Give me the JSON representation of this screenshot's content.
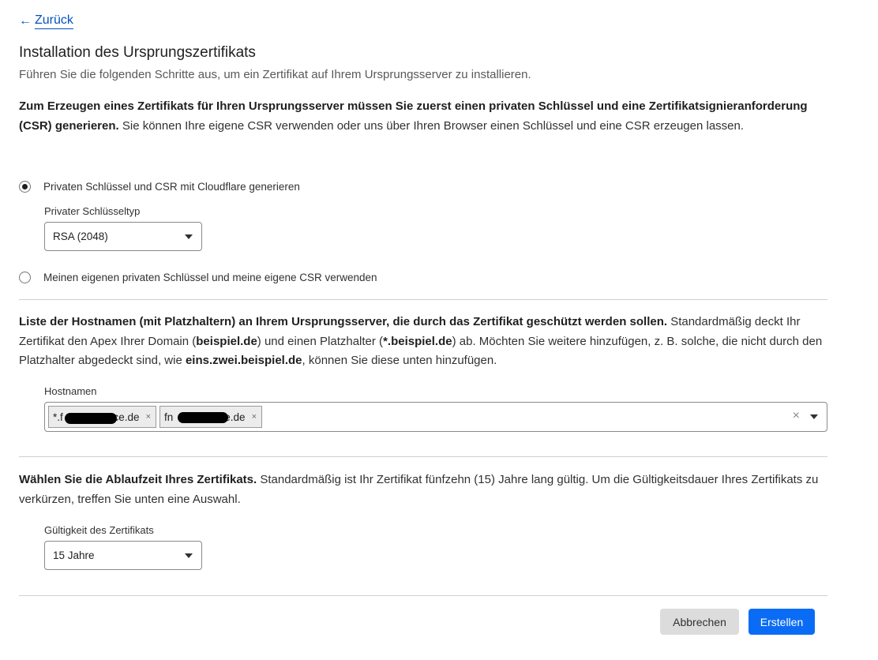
{
  "nav": {
    "back_arrow": "←",
    "back_label": "Zurück"
  },
  "header": {
    "title": "Installation des Ursprungszertifikats",
    "subtitle": "Führen Sie die folgenden Schritte aus, um ein Zertifikat auf Ihrem Ursprungsserver zu installieren."
  },
  "key_section": {
    "intro_bold": "Zum Erzeugen eines Zertifikats für Ihren Ursprungsserver müssen Sie zuerst einen privaten Schlüssel und eine Zertifikatsignieranforderung (CSR) generieren.",
    "intro_rest": " Sie können Ihre eigene CSR verwenden oder uns über Ihren Browser einen Schlüssel und eine CSR erzeugen lassen.",
    "option_generate": {
      "label": "Privaten Schlüssel und CSR mit Cloudflare generieren",
      "selected": true
    },
    "key_type_label": "Privater Schlüsseltyp",
    "key_type_value": "RSA (2048)",
    "option_own": {
      "label": "Meinen eigenen privaten Schlüssel und meine eigene CSR verwenden",
      "selected": false
    }
  },
  "hostnames_section": {
    "intro_bold": "Liste der Hostnamen (mit Platzhaltern) an Ihrem Ursprungsserver, die durch das Zertifikat geschützt werden sollen.",
    "intro_part1": " Standardmäßig deckt Ihr Zertifikat den Apex Ihrer Domain (",
    "example_apex": "beispiel.de",
    "intro_part2": ") und einen Platzhalter (",
    "example_wildcard": "*.beispiel.de",
    "intro_part3": ") ab. Möchten Sie weitere hinzufügen, z. B. solche, die nicht durch den Platzhalter abgedeckt sind, wie ",
    "example_sub": "eins.zwei.beispiel.de",
    "intro_part4": ", können Sie diese unten hinzufügen.",
    "field_label": "Hostnamen",
    "chips": [
      {
        "visible_prefix": "*.f",
        "visible_suffix": "ce.de",
        "remove": "×"
      },
      {
        "visible_prefix": "fn",
        "visible_suffix": "e.de",
        "remove": "×"
      }
    ],
    "clear_symbol": "×"
  },
  "validity_section": {
    "intro_bold": "Wählen Sie die Ablaufzeit Ihres Zertifikats.",
    "intro_rest": " Standardmäßig ist Ihr Zertifikat fünfzehn (15) Jahre lang gültig. Um die Gültigkeitsdauer Ihres Zertifikats zu verkürzen, treffen Sie unten eine Auswahl.",
    "field_label": "Gültigkeit des Zertifikats",
    "value": "15 Jahre"
  },
  "actions": {
    "cancel_label": "Abbrechen",
    "create_label": "Erstellen"
  },
  "colors": {
    "link": "#0051c3",
    "primary_button": "#0a6cf5",
    "secondary_button": "#dcdcdc"
  }
}
